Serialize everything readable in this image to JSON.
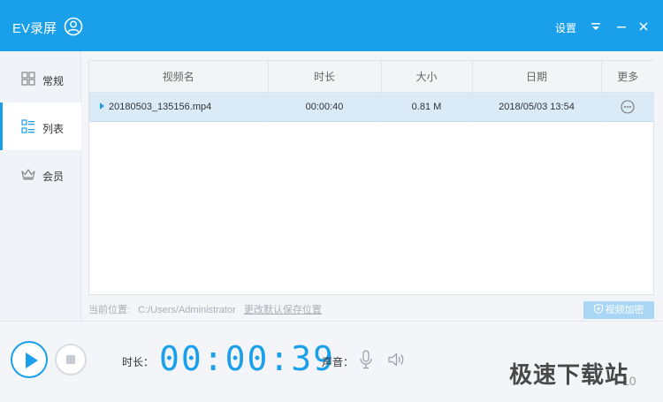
{
  "titlebar": {
    "app_title": "EV录屏",
    "settings_label": "设置",
    "bg_color": "#1a9fea"
  },
  "sidebar": {
    "items": [
      {
        "label": "常规",
        "icon": "grid-icon",
        "active": false
      },
      {
        "label": "列表",
        "icon": "list-icon",
        "active": true
      },
      {
        "label": "会员",
        "icon": "crown-icon",
        "active": false
      }
    ]
  },
  "table": {
    "columns": [
      "视频名",
      "时长",
      "大小",
      "日期",
      "更多"
    ],
    "rows": [
      {
        "name": "20180503_135156.mp4",
        "duration": "00:00:40",
        "size": "0.81 M",
        "date": "2018/05/03 13:54",
        "more_icon": "ellipsis-circle-icon",
        "selected": true
      }
    ]
  },
  "location": {
    "label": "当前位置:",
    "path": "C:/Users/Administrator",
    "change_link": "更改默认保存位置"
  },
  "encrypt_button": {
    "label": "视频加密",
    "icon": "shield-icon"
  },
  "controls": {
    "duration_label": "时长：",
    "timer": "00:00:39",
    "sound_label": "声音：",
    "version": "10"
  },
  "watermark": "极速下载站"
}
